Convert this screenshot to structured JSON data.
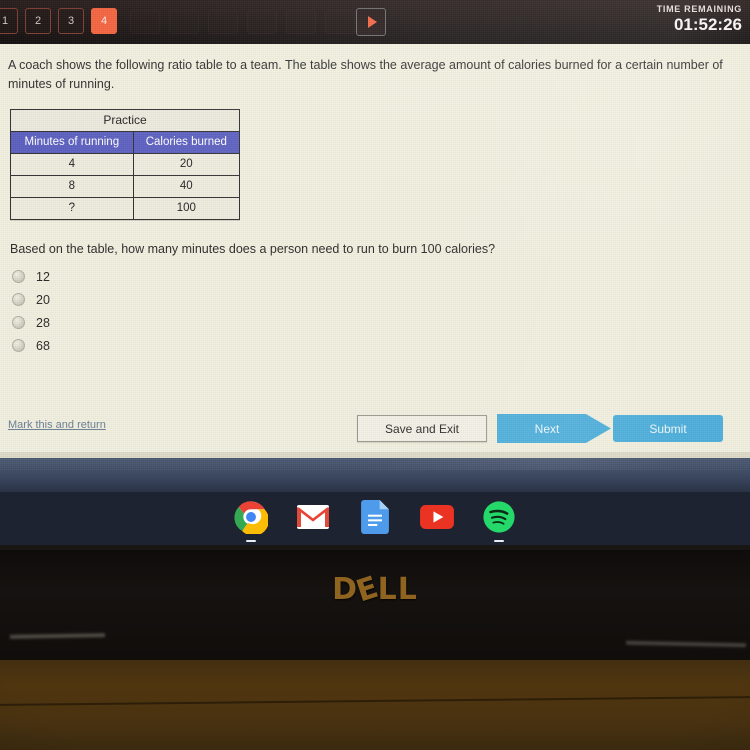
{
  "topbar": {
    "question_tabs": [
      {
        "label": "1",
        "active": false
      },
      {
        "label": "2",
        "active": false
      },
      {
        "label": "3",
        "active": false
      },
      {
        "label": "4",
        "active": true
      }
    ],
    "play_button_label": "▶",
    "timer_label": "TIME REMAINING",
    "timer_value": "01:52:26",
    "active_tab_color": "#f4613c",
    "bar_color": "#171211"
  },
  "question": {
    "stem": "A coach shows the following ratio table to a team. The table shows the average amount of calories burned for a certain number of minutes of running.",
    "prompt": "Based on the table, how many minutes does a person need to run to burn 100 calories?",
    "choices": [
      {
        "label": "12",
        "selected": false
      },
      {
        "label": "20",
        "selected": false
      },
      {
        "label": "28",
        "selected": false
      },
      {
        "label": "68",
        "selected": false
      }
    ]
  },
  "table": {
    "title": "Practice",
    "headers": [
      "Minutes of running",
      "Calories burned"
    ],
    "header_bg": "#5b5fc0",
    "rows": [
      [
        "4",
        "20"
      ],
      [
        "8",
        "40"
      ],
      [
        "?",
        "100"
      ]
    ]
  },
  "footer": {
    "mark_link": "Mark this and return",
    "save_label": "Save and Exit",
    "next_label": "Next",
    "submit_label": "Submit",
    "button_color": "#4fb0dc"
  },
  "shelf": {
    "items": [
      {
        "name": "chrome-icon",
        "label": "Chrome",
        "running": true
      },
      {
        "name": "gmail-icon",
        "label": "Gmail",
        "running": false
      },
      {
        "name": "google-docs-icon",
        "label": "Docs",
        "running": false
      },
      {
        "name": "youtube-icon",
        "label": "YouTube",
        "running": false
      },
      {
        "name": "spotify-icon",
        "label": "Spotify",
        "running": true
      }
    ],
    "bg_color": "#1d2330"
  },
  "laptop": {
    "brand": "DELL",
    "brand_color": "#9a6a22"
  }
}
